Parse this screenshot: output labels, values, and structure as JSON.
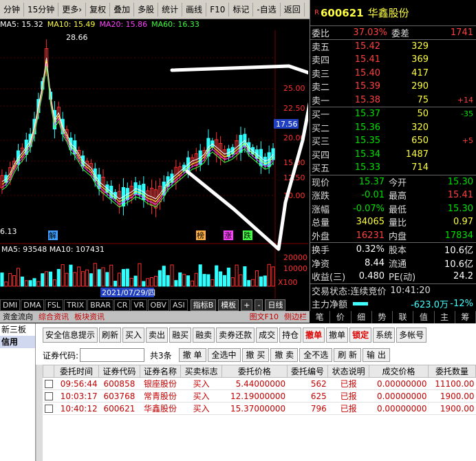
{
  "toolbar": [
    "分钟",
    "15分钟",
    "更多›",
    "复权",
    "叠加",
    "多股",
    "统计",
    "画线",
    "F10",
    "标记",
    "-自选",
    "返回"
  ],
  "ma_line": [
    {
      "text": "MA5: 15.32",
      "color": "#ffffff"
    },
    {
      "text": "MA10: 15.49",
      "color": "#ffff40"
    },
    {
      "text": "MA20: 15.86",
      "color": "#ff40ff"
    },
    {
      "text": "MA60: 16.33",
      "color": "#40ff40"
    }
  ],
  "chart_labels": {
    "high": "28.66",
    "low": "6.13",
    "price_ticks": [
      "25.00",
      "22.50",
      "20.00",
      "15.00",
      "12.50",
      "10.00"
    ],
    "current": "17.56",
    "vol_ma": "MA5: 93548  MA10: 107431",
    "vol_ticks": [
      "20000",
      "10000",
      "X100"
    ],
    "date_cursor": "2021/07/29/四",
    "markers": [
      "解",
      "榜",
      "涨",
      "跌"
    ]
  },
  "bottom_tabs": [
    "DMI",
    "DMA",
    "FSL",
    "TRIX",
    "BRAR",
    "CR",
    "VR",
    "OBV",
    "ASI"
  ],
  "bottom_tabs_right": [
    "指标B",
    "模板",
    "+",
    "-"
  ],
  "period_label": "日线",
  "info_tabs": [
    "资金流向",
    "综合资讯",
    "板块资讯"
  ],
  "info_tabs_right": [
    "图文F10",
    "侧边栏"
  ],
  "stock": {
    "code": "600621",
    "name": "华鑫股份",
    "market": "R"
  },
  "weibi": {
    "label": "委比",
    "value": "37.03%",
    "label2": "委差",
    "value2": "1741"
  },
  "sell": [
    {
      "label": "卖五",
      "price": "15.42",
      "vol": "329",
      "chg": ""
    },
    {
      "label": "卖四",
      "price": "15.41",
      "vol": "369",
      "chg": ""
    },
    {
      "label": "卖三",
      "price": "15.40",
      "vol": "417",
      "chg": ""
    },
    {
      "label": "卖二",
      "price": "15.39",
      "vol": "290",
      "chg": ""
    },
    {
      "label": "卖一",
      "price": "15.38",
      "vol": "75",
      "chg": "+14"
    }
  ],
  "buy": [
    {
      "label": "买一",
      "price": "15.37",
      "vol": "50",
      "chg": "-35"
    },
    {
      "label": "买二",
      "price": "15.36",
      "vol": "320",
      "chg": ""
    },
    {
      "label": "买三",
      "price": "15.35",
      "vol": "650",
      "chg": "+5"
    },
    {
      "label": "买四",
      "price": "15.34",
      "vol": "1487",
      "chg": ""
    },
    {
      "label": "买五",
      "price": "15.33",
      "vol": "714",
      "chg": ""
    }
  ],
  "stats": [
    {
      "l": "现价",
      "a": "15.37",
      "ac": "green",
      "m": "今开",
      "b": "15.30",
      "bc": "green"
    },
    {
      "l": "涨跌",
      "a": "-0.01",
      "ac": "green",
      "m": "最高",
      "b": "15.41",
      "bc": "red"
    },
    {
      "l": "涨幅",
      "a": "-0.07%",
      "ac": "green",
      "m": "最低",
      "b": "15.30",
      "bc": "green"
    },
    {
      "l": "总量",
      "a": "34065",
      "ac": "yellow",
      "m": "量比",
      "b": "0.97",
      "bc": "yellow"
    },
    {
      "l": "外盘",
      "a": "16231",
      "ac": "red",
      "m": "内盘",
      "b": "17834",
      "bc": "green"
    }
  ],
  "stats2": [
    {
      "l": "换手",
      "a": "0.32%",
      "ac": "white",
      "m": "股本",
      "b": "10.6亿",
      "bc": "white"
    },
    {
      "l": "净资",
      "a": "8.44",
      "ac": "white",
      "m": "流通",
      "b": "10.6亿",
      "bc": "white"
    },
    {
      "l": "收益(三)",
      "a": "0.480",
      "ac": "white",
      "m": "PE(动)",
      "b": "24.2",
      "bc": "white"
    }
  ],
  "trade_status": {
    "label": "交易状态:",
    "value": "连续竞价",
    "time": "10:41:20"
  },
  "main_net": {
    "label": "主力净额",
    "value": "-623.0万",
    "pct": "-12%"
  },
  "quote_tabs": [
    "笔",
    "价",
    "细",
    "势",
    "联",
    "值",
    "主",
    "筹"
  ],
  "left_panel": [
    "新三板",
    "信用"
  ],
  "action_buttons": [
    {
      "label": "安全信息提示",
      "active": false
    },
    {
      "label": "刷新",
      "active": false
    },
    {
      "label": "买入",
      "active": false
    },
    {
      "label": "卖出",
      "active": false
    },
    {
      "label": "融买",
      "active": false
    },
    {
      "label": "融卖",
      "active": false
    },
    {
      "label": "卖券还款",
      "active": false
    },
    {
      "label": "成交",
      "active": false
    },
    {
      "label": "持仓",
      "active": false
    },
    {
      "label": "撤单",
      "active": true
    },
    {
      "label": "撤单",
      "active": false
    },
    {
      "label": "锁定",
      "active": true
    },
    {
      "label": "系统",
      "active": false
    },
    {
      "label": "多帐号",
      "active": false
    }
  ],
  "filter": {
    "label": "证券代码:",
    "count": "共3条",
    "buttons": [
      "撤 单",
      "全选中",
      "撤 买",
      "撤 卖",
      "全不选",
      "刷 新",
      "输 出"
    ]
  },
  "orders": {
    "headers": [
      "委托时间",
      "证券代码",
      "证券名称",
      "买卖标志",
      "委托价格",
      "委托编号",
      "状态说明",
      "成交价格",
      "委托数量"
    ],
    "rows": [
      [
        "09:56:44",
        "600858",
        "银座股份",
        "买入",
        "5.44000000",
        "562",
        "已报",
        "0.00000000",
        "11100.00"
      ],
      [
        "10:03:17",
        "603768",
        "常青股份",
        "买入",
        "12.19000000",
        "625",
        "已报",
        "0.00000000",
        "1900.00"
      ],
      [
        "10:40:12",
        "600621",
        "华鑫股份",
        "买入",
        "15.37000000",
        "796",
        "已报",
        "0.00000000",
        "1900.00"
      ]
    ]
  }
}
